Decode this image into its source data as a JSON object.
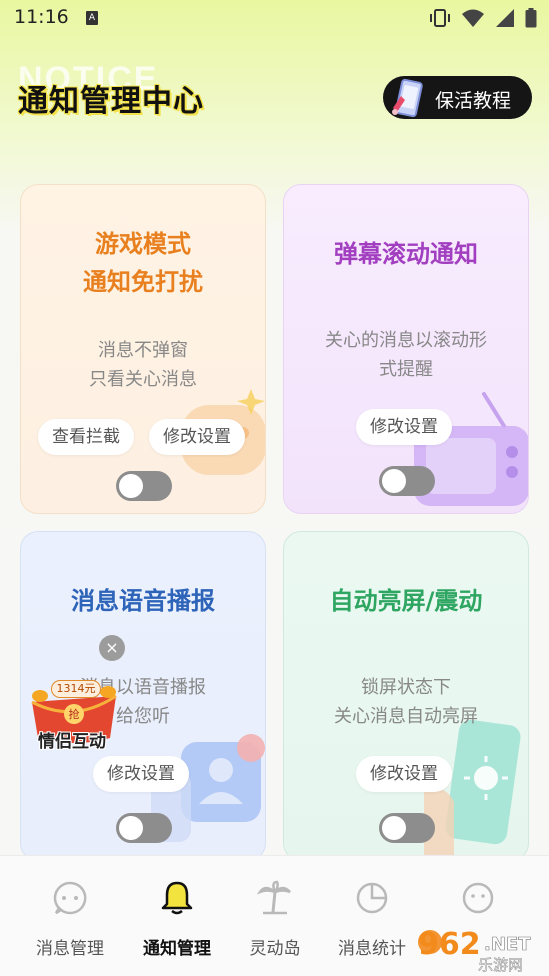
{
  "status_bar": {
    "time": "11:16",
    "indicator": "A",
    "icons": [
      "vibrate-icon",
      "wifi-icon",
      "signal-icon",
      "battery-icon"
    ]
  },
  "header": {
    "title": "通知管理中心",
    "background_word": "NOTICE",
    "tutorial_button": "保活教程"
  },
  "cards": [
    {
      "title_lines": [
        "游戏模式",
        "通知免打扰"
      ],
      "desc_lines": [
        "消息不弹窗",
        "只看关心消息"
      ],
      "buttons": [
        "查看拦截",
        "修改设置"
      ],
      "toggle_on": false,
      "accent": "#e9801f"
    },
    {
      "title_lines": [
        "弹幕滚动通知"
      ],
      "desc_lines": [
        "关心的消息以滚动形",
        "式提醒"
      ],
      "buttons": [
        "修改设置"
      ],
      "toggle_on": false,
      "accent": "#a23ec0"
    },
    {
      "title_lines": [
        "消息语音播报"
      ],
      "desc_lines": [
        "消息以语音播报",
        "给您听"
      ],
      "buttons": [
        "修改设置"
      ],
      "toggle_on": false,
      "accent": "#2d63b8"
    },
    {
      "title_lines": [
        "自动亮屏/震动"
      ],
      "desc_lines": [
        "锁屏状态下",
        "关心消息自动亮屏"
      ],
      "buttons": [
        "修改设置"
      ],
      "toggle_on": false,
      "accent": "#2ea662"
    }
  ],
  "floating_ad": {
    "close_glyph": "×",
    "price": "1314元",
    "grab_char": "抢",
    "label": "情侣互动"
  },
  "bottom_nav": {
    "items": [
      {
        "label": "消息管理",
        "icon": "chat-bubble-icon",
        "active": false
      },
      {
        "label": "通知管理",
        "icon": "bell-icon",
        "active": true
      },
      {
        "label": "灵动岛",
        "icon": "palm-tree-icon",
        "active": false
      },
      {
        "label": "消息统计",
        "icon": "pie-chart-icon",
        "active": false
      },
      {
        "label": "",
        "icon": "face-icon",
        "active": false
      }
    ]
  },
  "watermark": {
    "number": "962",
    "suffix": ".NET",
    "sub": "乐游网"
  }
}
